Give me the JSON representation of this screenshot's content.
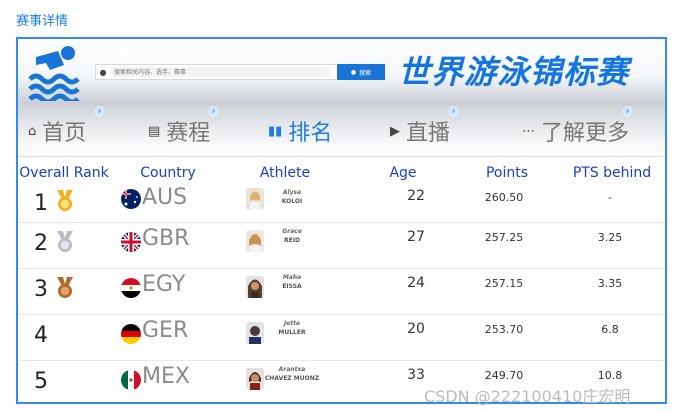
{
  "page": {
    "label": "赛事详情"
  },
  "header": {
    "search": {
      "placeholder": "搜索相关内容、选手、赛事",
      "button_label": "搜索"
    },
    "title": "世界游泳锦标赛"
  },
  "nav": {
    "tabs": [
      {
        "label": "首页",
        "icon": "home-icon",
        "active": false
      },
      {
        "label": "赛程",
        "icon": "schedule-icon",
        "active": false
      },
      {
        "label": "排名",
        "icon": "ranking-icon",
        "active": true
      },
      {
        "label": "直播",
        "icon": "play-icon",
        "active": false
      },
      {
        "label": "了解更多",
        "icon": "more-icon",
        "active": false
      }
    ]
  },
  "table": {
    "headers": {
      "rank": "Overall Rank",
      "country": "Country",
      "athlete": "Athlete",
      "age": "Age",
      "points": "Points",
      "behind": "PTS behind"
    },
    "rows": [
      {
        "rank": "1",
        "medal": "gold",
        "country": "AUS",
        "first": "Alysa",
        "last": "KOLOI",
        "age": "22",
        "points": "260.50",
        "behind": "-"
      },
      {
        "rank": "2",
        "medal": "silver",
        "country": "GBR",
        "first": "Grace",
        "last": "REID",
        "age": "27",
        "points": "257.25",
        "behind": "3.25"
      },
      {
        "rank": "3",
        "medal": "bronze",
        "country": "EGY",
        "first": "Maha",
        "last": "EISSA",
        "age": "24",
        "points": "257.15",
        "behind": "3.35"
      },
      {
        "rank": "4",
        "medal": "",
        "country": "GER",
        "first": "Jette",
        "last": "MULLER",
        "age": "20",
        "points": "253.70",
        "behind": "6.8"
      },
      {
        "rank": "5",
        "medal": "",
        "country": "MEX",
        "first": "Arantxa",
        "last": "CHAVEZ MUONZ",
        "age": "33",
        "points": "249.70",
        "behind": "10.8"
      }
    ]
  },
  "colors": {
    "accent": "#1f7fe0",
    "header_text": "#1b3fc4",
    "gold": "#f2b01e",
    "silver": "#b9bcc2",
    "bronze": "#b06a2c"
  },
  "watermark": "CSDN @222100410庄宏明"
}
